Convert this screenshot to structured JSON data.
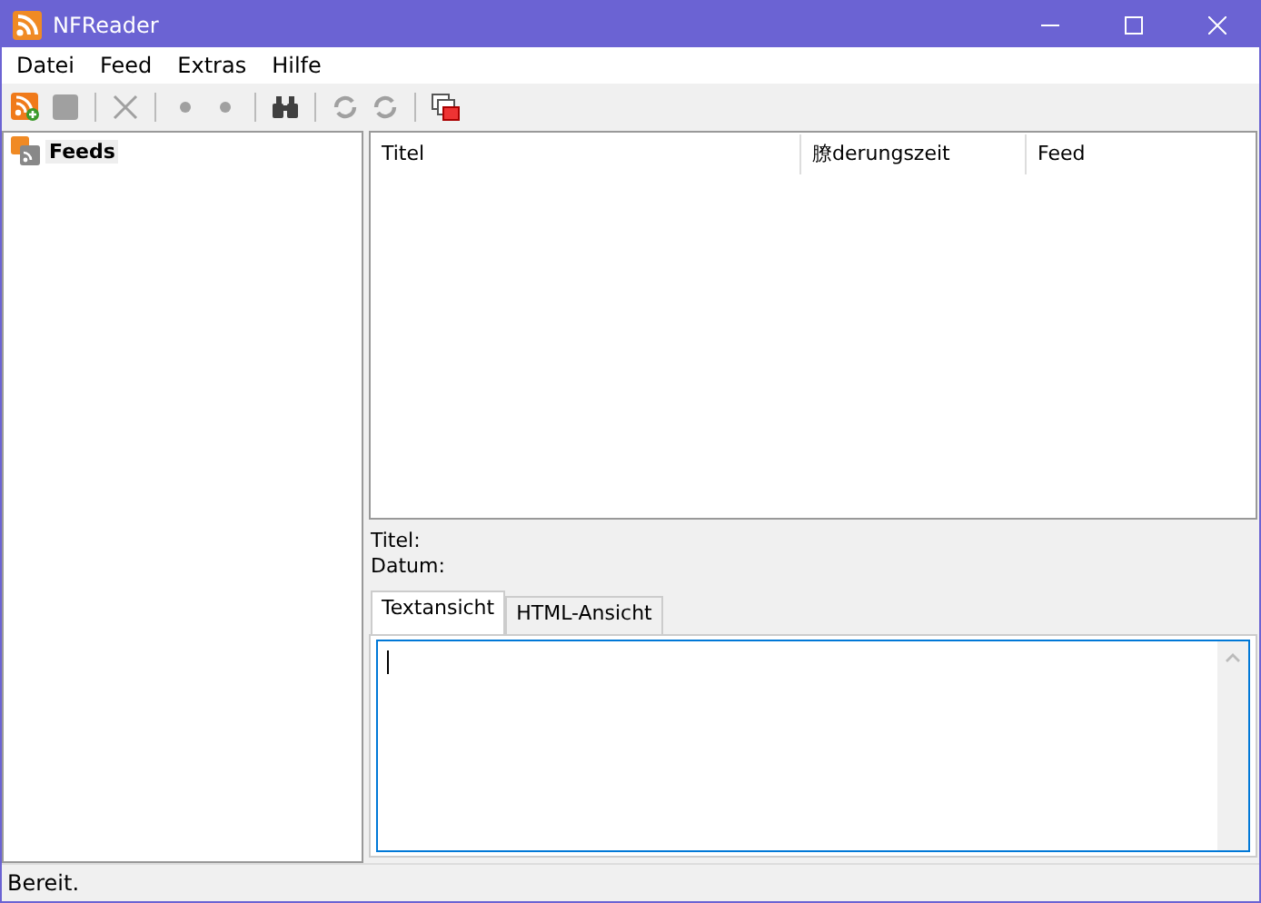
{
  "window": {
    "title": "NFReader"
  },
  "menu": [
    "Datei",
    "Feed",
    "Extras",
    "Hilfe"
  ],
  "toolbar": [
    {
      "kind": "feed-add",
      "disabled": false
    },
    {
      "kind": "stop",
      "disabled": true
    },
    {
      "kind": "separator"
    },
    {
      "kind": "delete",
      "disabled": true
    },
    {
      "kind": "separator"
    },
    {
      "kind": "dot",
      "disabled": true
    },
    {
      "kind": "dot",
      "disabled": true
    },
    {
      "kind": "separator"
    },
    {
      "kind": "binoculars",
      "disabled": false
    },
    {
      "kind": "separator"
    },
    {
      "kind": "refresh",
      "disabled": true
    },
    {
      "kind": "refresh",
      "disabled": true
    },
    {
      "kind": "separator"
    },
    {
      "kind": "windows",
      "disabled": false
    }
  ],
  "tree": {
    "items": [
      {
        "label": "Feeds",
        "selected": true
      }
    ]
  },
  "table": {
    "columns": [
      "Titel",
      "膫derungszeit",
      "Feed"
    ]
  },
  "details": [
    "Titel:",
    "Datum:"
  ],
  "tabs": [
    {
      "label": "Textansicht",
      "selected": true
    },
    {
      "label": "HTML-Ansicht",
      "selected": false
    }
  ],
  "status_bar": "Bereit."
}
